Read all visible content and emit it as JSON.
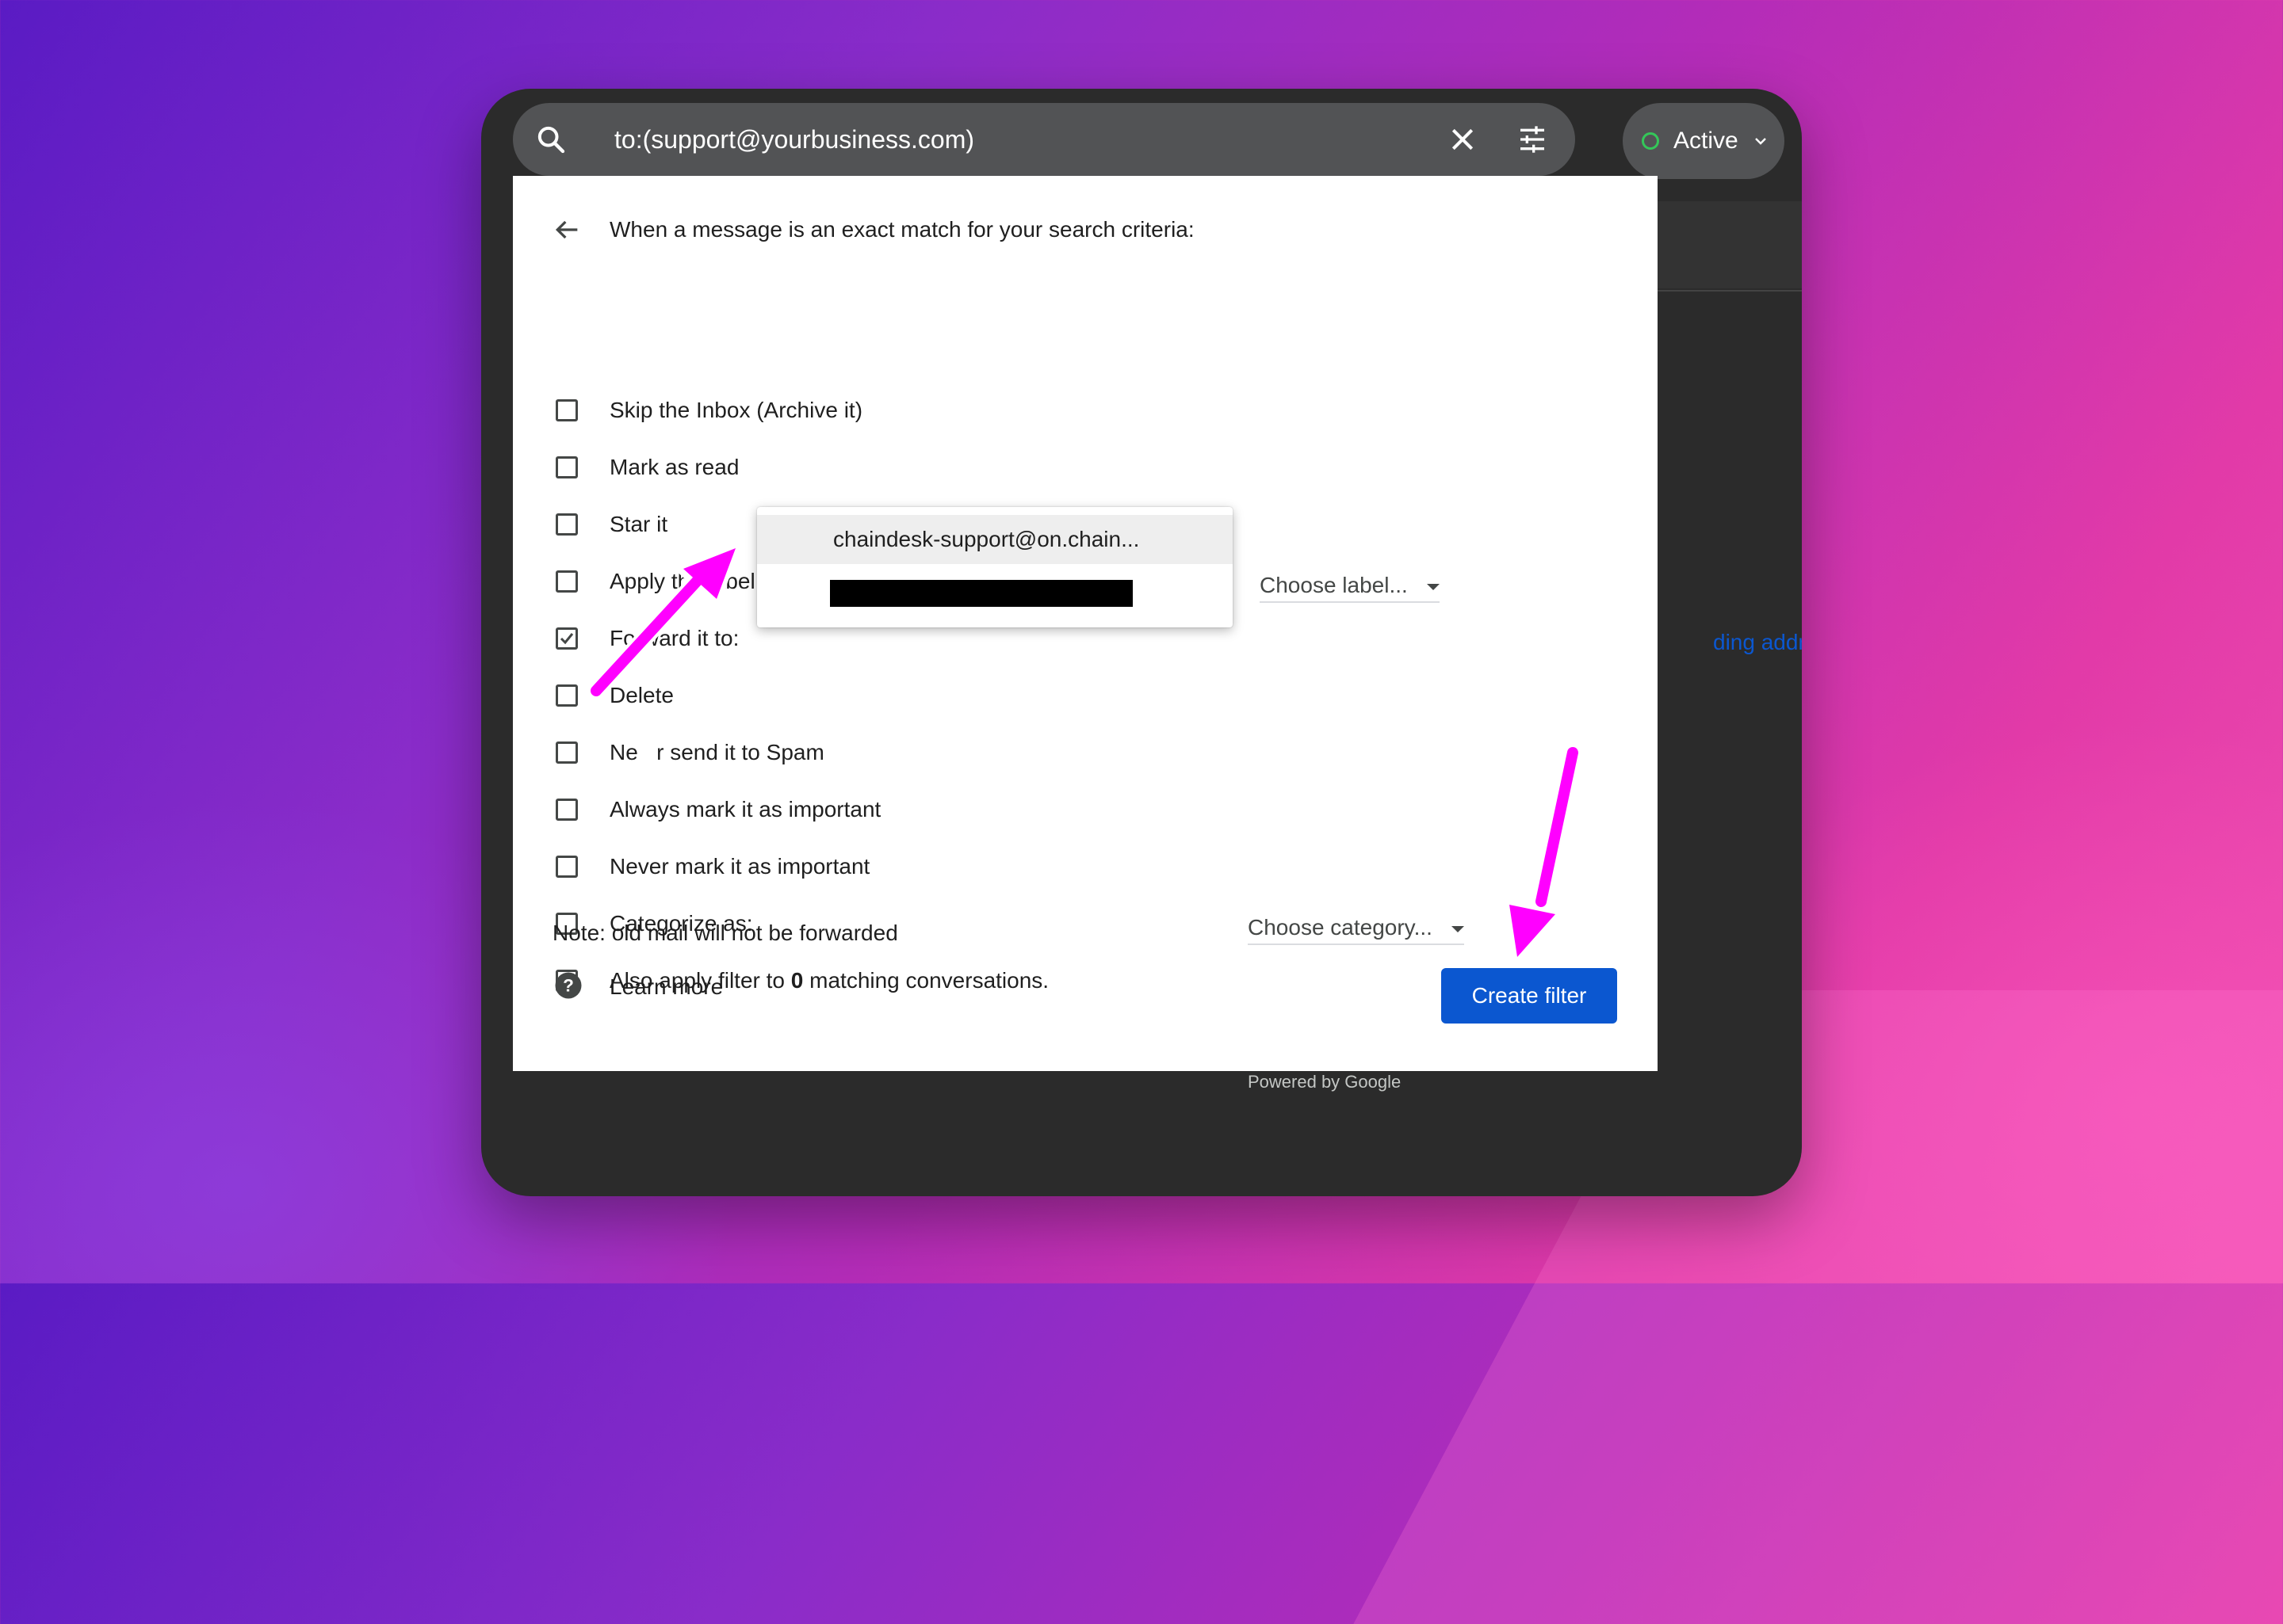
{
  "search": {
    "query": "to:(support@yourbusiness.com)"
  },
  "status": {
    "label": "Active",
    "dot_color": "#34c759"
  },
  "filter": {
    "header": "When a message is an exact match for your search criteria:",
    "options": {
      "skip_inbox": "Skip the Inbox (Archive it)",
      "mark_read": "Mark as read",
      "star": "Star it",
      "apply_label": "Apply the label:",
      "forward": "Forward it to:",
      "delete": "Delete",
      "never_spam": "Ne   r send it to Spam",
      "always_important": "Always mark it as important",
      "never_important": "Never mark it as important",
      "categorize": "Categorize as:",
      "also_apply_prefix": "Also apply filter to ",
      "also_apply_count": "0",
      "also_apply_suffix": " matching conversations."
    },
    "label_select": "Choose label...",
    "category_select": "Choose category...",
    "forward_link_partial": "ding address",
    "forward_checked": true,
    "note": "Note: old mail will not be forwarded",
    "learn_more": "Learn more",
    "create_button": "Create filter"
  },
  "forward_dropdown": {
    "items": [
      "chaindesk-support@on.chain..."
    ]
  },
  "footer": {
    "powered": "Powered by Google"
  },
  "colors": {
    "accent": "#0b57d0",
    "annotation_arrow": "#ff00ff"
  },
  "icons": [
    "search-icon",
    "close-icon",
    "tune-icon",
    "chevron-down-icon",
    "back-arrow-icon",
    "help-icon",
    "check-icon"
  ]
}
